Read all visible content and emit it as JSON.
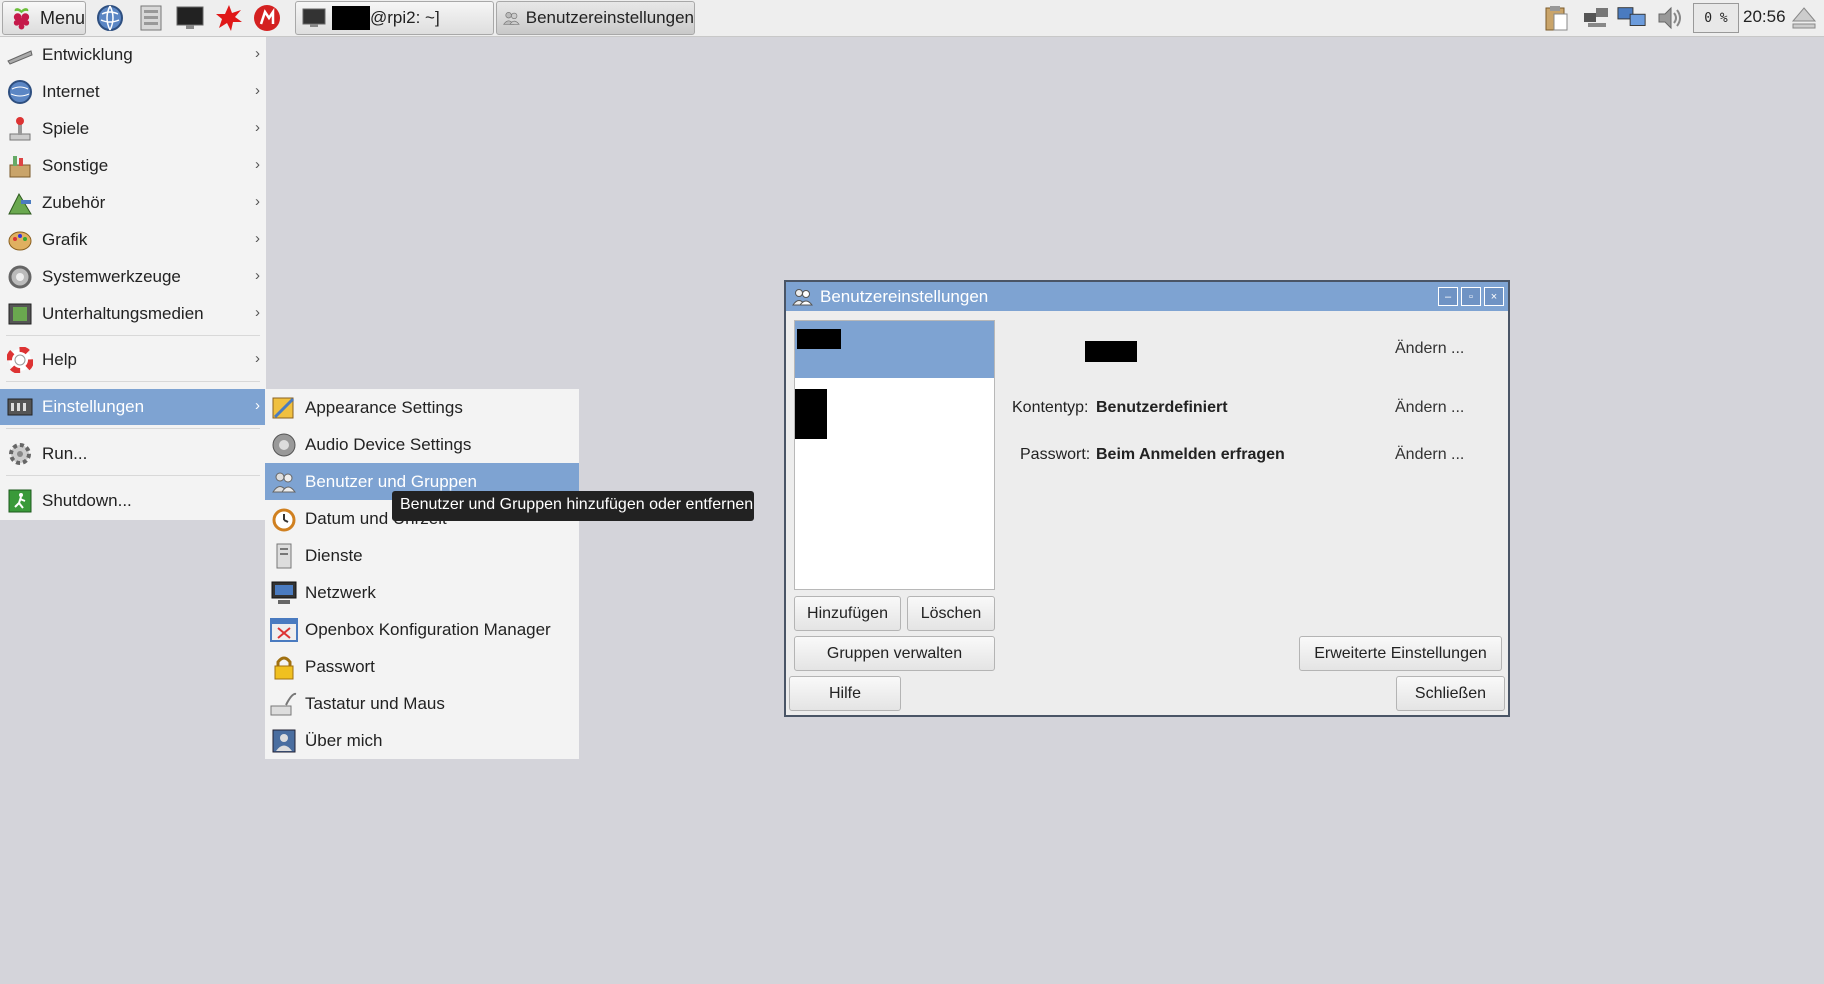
{
  "taskbar": {
    "menu_label": "Menu",
    "terminal_task": "@rpi2: ~]",
    "user_task": "Benutzereinstellungen",
    "cpu": "0 %",
    "clock": "20:56"
  },
  "start_menu": {
    "items": [
      {
        "label": "Entwicklung",
        "icon": "development-icon"
      },
      {
        "label": "Internet",
        "icon": "internet-globe-icon"
      },
      {
        "label": "Spiele",
        "icon": "games-icon"
      },
      {
        "label": "Sonstige",
        "icon": "misc-icon"
      },
      {
        "label": "Zubehör",
        "icon": "accessories-icon"
      },
      {
        "label": "Grafik",
        "icon": "graphics-palette-icon"
      },
      {
        "label": "Systemwerkzeuge",
        "icon": "system-tools-icon"
      },
      {
        "label": "Unterhaltungsmedien",
        "icon": "multimedia-icon"
      },
      {
        "label": "Help",
        "icon": "help-lifebuoy-icon"
      },
      {
        "label": "Einstellungen",
        "icon": "settings-icon"
      },
      {
        "label": "Run...",
        "icon": "run-gear-icon"
      },
      {
        "label": "Shutdown...",
        "icon": "shutdown-exit-icon"
      }
    ]
  },
  "submenu": {
    "items": [
      {
        "label": "Appearance Settings",
        "icon": "appearance-icon"
      },
      {
        "label": "Audio Device Settings",
        "icon": "audio-device-icon"
      },
      {
        "label": "Benutzer und Gruppen",
        "icon": "users-groups-icon"
      },
      {
        "label": "Datum und Uhrzeit",
        "icon": "clock-icon"
      },
      {
        "label": "Dienste",
        "icon": "services-icon"
      },
      {
        "label": "Netzwerk",
        "icon": "network-icon"
      },
      {
        "label": "Openbox Konfiguration Manager",
        "icon": "openbox-config-icon"
      },
      {
        "label": "Passwort",
        "icon": "padlock-icon"
      },
      {
        "label": "Tastatur und Maus",
        "icon": "keyboard-mouse-icon"
      },
      {
        "label": "Über mich",
        "icon": "about-me-icon"
      }
    ]
  },
  "tooltip": "Benutzer und Gruppen hinzufügen oder entfernen",
  "dialog": {
    "title": "Benutzereinstellungen",
    "account_type_label": "Kontentyp:",
    "account_type_value": "Benutzerdefiniert",
    "password_label": "Passwort:",
    "password_value": "Beim Anmelden erfragen",
    "change_label": "Ändern ...",
    "add_button": "Hinzufügen",
    "delete_button": "Löschen",
    "manage_groups_button": "Gruppen verwalten",
    "advanced_button": "Erweiterte Einstellungen",
    "help_button": "Hilfe",
    "close_button": "Schließen"
  },
  "colors": {
    "selection": "#7ea3d2",
    "desktop": "#d4d4da",
    "menu_bg": "#f3f3f3"
  }
}
